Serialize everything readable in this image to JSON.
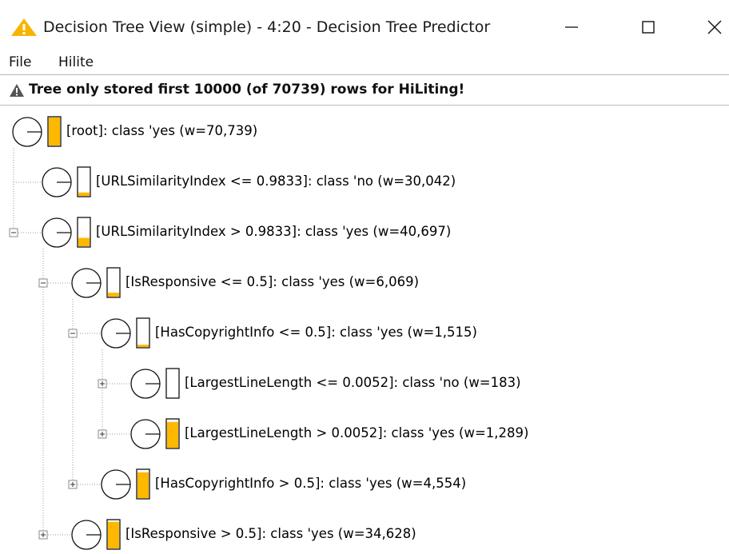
{
  "window": {
    "title": "Decision Tree View (simple) - 4:20 - Decision Tree Predictor",
    "accent_color": "#f7b500"
  },
  "menu": {
    "file": "File",
    "hilite": "Hilite"
  },
  "warning": {
    "text": "Tree only stored first 10000 (of 70739) rows for HiLiting!"
  },
  "tree": {
    "bar_fill_color": "#ffb800",
    "nodes": [
      {
        "id": "root",
        "label": "[root]:  class 'yes (w=70,739)",
        "depth": 0,
        "fill": 1.0,
        "toggle": "none",
        "leaf": false
      },
      {
        "id": "url-le",
        "label": "[URLSimilarityIndex <= 0.9833]:  class 'no (w=30,042)",
        "depth": 1,
        "fill": 0.12,
        "toggle": "none",
        "leaf": true
      },
      {
        "id": "url-gt",
        "label": "[URLSimilarityIndex > 0.9833]:  class 'yes (w=40,697)",
        "depth": 1,
        "fill": 0.3,
        "toggle": "minus",
        "leaf": false
      },
      {
        "id": "resp-le",
        "label": "[IsResponsive <= 0.5]:  class 'yes (w=6,069)",
        "depth": 2,
        "fill": 0.14,
        "toggle": "minus",
        "leaf": false
      },
      {
        "id": "copy-le",
        "label": "[HasCopyrightInfo <= 0.5]:  class 'yes (w=1,515)",
        "depth": 3,
        "fill": 0.08,
        "toggle": "minus",
        "leaf": false
      },
      {
        "id": "lll-le",
        "label": "[LargestLineLength <= 0.0052]:  class 'no (w=183)",
        "depth": 4,
        "fill": 0.0,
        "toggle": "plus",
        "leaf": false
      },
      {
        "id": "lll-gt",
        "label": "[LargestLineLength > 0.0052]:  class 'yes (w=1,289)",
        "depth": 4,
        "fill": 0.92,
        "toggle": "plus",
        "leaf": false
      },
      {
        "id": "copy-gt",
        "label": "[HasCopyrightInfo > 0.5]:  class 'yes (w=4,554)",
        "depth": 3,
        "fill": 0.92,
        "toggle": "plus",
        "leaf": false
      },
      {
        "id": "resp-gt",
        "label": "[IsResponsive > 0.5]:  class 'yes (w=34,628)",
        "depth": 2,
        "fill": 0.95,
        "toggle": "plus",
        "leaf": false
      }
    ]
  }
}
